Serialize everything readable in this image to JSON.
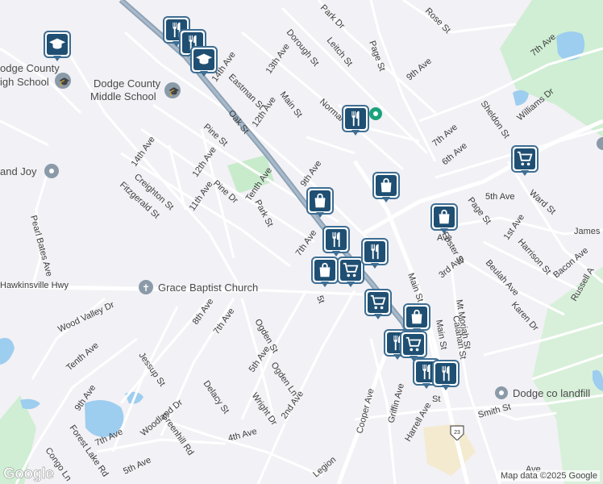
{
  "map": {
    "poi_labels": {
      "dodge_county_high_school": "Dodge County High School",
      "dodge_county_high_school_line1": "odge County",
      "dodge_county_high_school_line2": "igh School",
      "dodge_county_middle_school_line1": "Dodge County",
      "dodge_county_middle_school_line2": "Middle School",
      "land_joy": "and Joy",
      "grace_baptist": "Grace Baptist Church",
      "dodge_landfill": "Dodge co landfill"
    },
    "streets": {
      "oak_st": "Oak St",
      "main_st": "Main St",
      "page_st": "Page St",
      "rose_st": "Rose St",
      "park_dr": "Park Dr",
      "leitch_st": "Leitch St",
      "dorough_st": "Dorough St",
      "thirteenth_ave": "13th Ave",
      "fourteenth_ave": "14th Ave",
      "twelfth_ave": "12th Ave",
      "eastman_st": "Eastman St",
      "pine_st": "Pine St",
      "fourteenth_ave_b": "14th Ave",
      "twelfth_ave_b": "12th Ave",
      "creighton_st": "Creighton St",
      "fitzgerald_st": "Fitzgerald St",
      "eleventh_ave": "11th Ave",
      "pine_dr": "Pine Dr",
      "tenth_ave": "Tenth Ave",
      "park_st": "Park St",
      "ninth_ave": "9th Ave",
      "seventh_ave": "7th Ave",
      "normal": "Normal",
      "fifth_ave": "5th Ave",
      "ward_st": "Ward St",
      "first_ave": "1st Ave",
      "page_st_b": "Page St",
      "foster_st": "Foster St",
      "third_ave": "3rd Ave",
      "beulah_ave": "Beulah Ave",
      "harrison_st": "Harrison St",
      "bacon_ave": "Bacon Ave",
      "russell": "Russell A",
      "karen_dr": "Karen Dr",
      "james": "James",
      "sheldon_st": "Sheldon St",
      "williams_dr": "Williams Dr",
      "sixth_ave": "6th Ave",
      "seventh_ave_b": "7th Ave",
      "ninth_ave_b": "9th Ave",
      "seventh_ave_c": "7th Ave",
      "pearl_bates_ave": "Pearl Bates Ave",
      "hawkinsville_hwy": "Hawkinsville Hwy",
      "wood_valley_dr": "Wood Valley Dr",
      "eighth_ave": "8th Ave",
      "seventh_ave_d": "7th Ave",
      "ogden_st": "Ogden St",
      "fifth_ave_b": "5th Ave",
      "ogden_ln": "Ogden Ln",
      "tenth_ave_b": "Tenth Ave",
      "jessup_st": "Jessup St",
      "delacy_st": "Delacy St",
      "wright_dr": "Wright Dr",
      "second_ave": "2nd Ave",
      "ninth_ave_c": "9th Ave",
      "greenhill_rd": "Greenhill Rd",
      "seventh_ave_e": "7th Ave",
      "woodland_dr": "Woodland Dr",
      "fourth_ave": "4th Ave",
      "forest_lake_rd": "Forest Lake Rd",
      "fifth_ave_c": "5th Ave",
      "congo_ln": "Congo Ln",
      "legion": "Legion",
      "cooper_ave": "Cooper Ave",
      "griffin_ave": "Griffin Ave",
      "harrell_ave": "Harrell Ave",
      "mt_moriah_st": "Mt Moriah St",
      "calahan_st": "Calahan St",
      "main_st_b": "Main St",
      "smith_st": "Smith St",
      "main_st_c": "Main St",
      "st": "St",
      "ave": "Ave",
      "ave_b": "Ave",
      "fifth": "5t"
    },
    "route_shield": "23",
    "google_logo": "Google",
    "attribution": "Map data ©2025 Google"
  },
  "markers": [
    {
      "type": "school",
      "icon": "graduation-cap-icon"
    },
    {
      "type": "restaurant",
      "icon": "fork-knife-icon"
    },
    {
      "type": "restaurant",
      "icon": "fork-knife-icon"
    },
    {
      "type": "school",
      "icon": "graduation-cap-icon"
    },
    {
      "type": "restaurant",
      "icon": "fork-knife-icon"
    },
    {
      "type": "grocery",
      "icon": "shopping-cart-icon"
    },
    {
      "type": "shopping",
      "icon": "shopping-bag-icon"
    },
    {
      "type": "shopping",
      "icon": "shopping-bag-icon"
    },
    {
      "type": "restaurant",
      "icon": "fork-knife-icon"
    },
    {
      "type": "shopping",
      "icon": "shopping-bag-icon"
    },
    {
      "type": "grocery",
      "icon": "shopping-cart-icon"
    },
    {
      "type": "shopping",
      "icon": "shopping-bag-icon"
    },
    {
      "type": "restaurant",
      "icon": "fork-knife-icon"
    },
    {
      "type": "grocery",
      "icon": "shopping-cart-icon"
    },
    {
      "type": "shopping",
      "icon": "shopping-bag-icon"
    },
    {
      "type": "restaurant",
      "icon": "fork-knife-icon"
    },
    {
      "type": "grocery",
      "icon": "shopping-cart-icon"
    },
    {
      "type": "restaurant",
      "icon": "fork-knife-icon"
    },
    {
      "type": "restaurant",
      "icon": "fork-knife-icon"
    }
  ],
  "colors": {
    "background": "#f2f1f5",
    "road": "#ffffff",
    "highway": "#8ea3b6",
    "park": "#c8ebcc",
    "water": "#9dcdef",
    "marker_border": "#3e6e93",
    "marker_fill": "#1f4f72",
    "poi_green": "#1aa37a"
  }
}
